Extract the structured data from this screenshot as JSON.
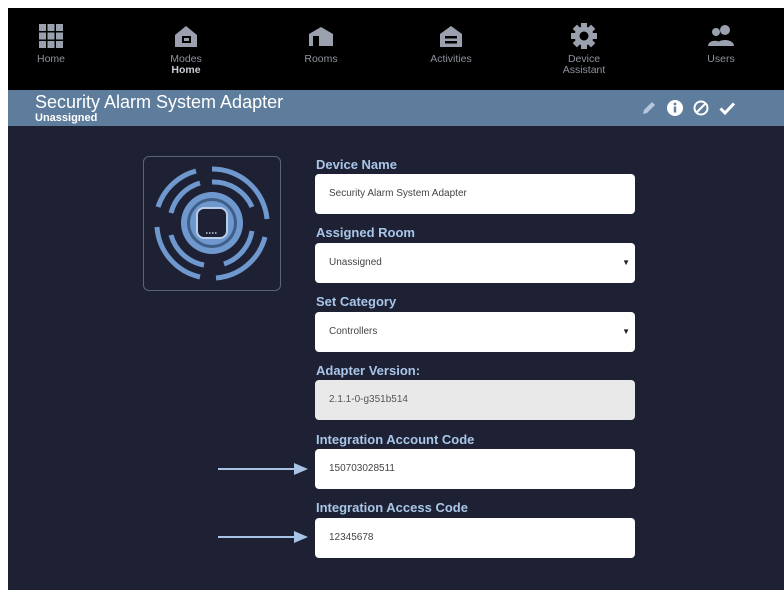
{
  "nav": {
    "items": [
      {
        "label": "Home",
        "sub": "",
        "icon": "grid-icon"
      },
      {
        "label": "Modes",
        "sub": "Home",
        "icon": "modes-icon"
      },
      {
        "label": "Rooms",
        "sub": "",
        "icon": "rooms-icon"
      },
      {
        "label": "Activities",
        "sub": "",
        "icon": "activities-icon"
      },
      {
        "label": "Device",
        "sub": "Assistant",
        "icon": "gear-icon"
      },
      {
        "label": "Users",
        "sub": "",
        "icon": "users-icon"
      }
    ]
  },
  "titlebar": {
    "title": "Security Alarm System Adapter",
    "subtitle": "Unassigned",
    "actions": [
      "pencil-icon",
      "info-icon",
      "cancel-icon",
      "check-icon"
    ]
  },
  "colors": {
    "background": "#1d2133",
    "titlebar": "#5e7d9c",
    "label": "#a9c6e8",
    "arrow": "#a7c4e6",
    "device_ring": "#6f98cf"
  },
  "form": {
    "device_name": {
      "label": "Device Name",
      "value": "Security Alarm System Adapter"
    },
    "assigned_room": {
      "label": "Assigned Room",
      "value": "Unassigned"
    },
    "set_category": {
      "label": "Set Category",
      "value": "Controllers"
    },
    "adapter_version": {
      "label": "Adapter Version:",
      "value": "2.1.1-0-g351b514"
    },
    "integration_account_code": {
      "label": "Integration Account Code",
      "value": "150703028511"
    },
    "integration_access_code": {
      "label": "Integration Access Code",
      "value": "12345678"
    }
  }
}
